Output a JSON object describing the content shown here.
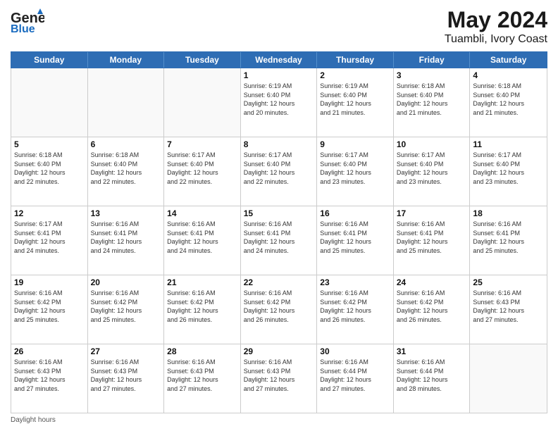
{
  "header": {
    "logo_line1": "General",
    "logo_line2": "Blue",
    "main_title": "May 2024",
    "subtitle": "Tuambli, Ivory Coast"
  },
  "calendar": {
    "weekdays": [
      "Sunday",
      "Monday",
      "Tuesday",
      "Wednesday",
      "Thursday",
      "Friday",
      "Saturday"
    ],
    "weeks": [
      [
        {
          "day": "",
          "info": ""
        },
        {
          "day": "",
          "info": ""
        },
        {
          "day": "",
          "info": ""
        },
        {
          "day": "1",
          "info": "Sunrise: 6:19 AM\nSunset: 6:40 PM\nDaylight: 12 hours\nand 20 minutes."
        },
        {
          "day": "2",
          "info": "Sunrise: 6:19 AM\nSunset: 6:40 PM\nDaylight: 12 hours\nand 21 minutes."
        },
        {
          "day": "3",
          "info": "Sunrise: 6:18 AM\nSunset: 6:40 PM\nDaylight: 12 hours\nand 21 minutes."
        },
        {
          "day": "4",
          "info": "Sunrise: 6:18 AM\nSunset: 6:40 PM\nDaylight: 12 hours\nand 21 minutes."
        }
      ],
      [
        {
          "day": "5",
          "info": "Sunrise: 6:18 AM\nSunset: 6:40 PM\nDaylight: 12 hours\nand 22 minutes."
        },
        {
          "day": "6",
          "info": "Sunrise: 6:18 AM\nSunset: 6:40 PM\nDaylight: 12 hours\nand 22 minutes."
        },
        {
          "day": "7",
          "info": "Sunrise: 6:17 AM\nSunset: 6:40 PM\nDaylight: 12 hours\nand 22 minutes."
        },
        {
          "day": "8",
          "info": "Sunrise: 6:17 AM\nSunset: 6:40 PM\nDaylight: 12 hours\nand 22 minutes."
        },
        {
          "day": "9",
          "info": "Sunrise: 6:17 AM\nSunset: 6:40 PM\nDaylight: 12 hours\nand 23 minutes."
        },
        {
          "day": "10",
          "info": "Sunrise: 6:17 AM\nSunset: 6:40 PM\nDaylight: 12 hours\nand 23 minutes."
        },
        {
          "day": "11",
          "info": "Sunrise: 6:17 AM\nSunset: 6:40 PM\nDaylight: 12 hours\nand 23 minutes."
        }
      ],
      [
        {
          "day": "12",
          "info": "Sunrise: 6:17 AM\nSunset: 6:41 PM\nDaylight: 12 hours\nand 24 minutes."
        },
        {
          "day": "13",
          "info": "Sunrise: 6:16 AM\nSunset: 6:41 PM\nDaylight: 12 hours\nand 24 minutes."
        },
        {
          "day": "14",
          "info": "Sunrise: 6:16 AM\nSunset: 6:41 PM\nDaylight: 12 hours\nand 24 minutes."
        },
        {
          "day": "15",
          "info": "Sunrise: 6:16 AM\nSunset: 6:41 PM\nDaylight: 12 hours\nand 24 minutes."
        },
        {
          "day": "16",
          "info": "Sunrise: 6:16 AM\nSunset: 6:41 PM\nDaylight: 12 hours\nand 25 minutes."
        },
        {
          "day": "17",
          "info": "Sunrise: 6:16 AM\nSunset: 6:41 PM\nDaylight: 12 hours\nand 25 minutes."
        },
        {
          "day": "18",
          "info": "Sunrise: 6:16 AM\nSunset: 6:41 PM\nDaylight: 12 hours\nand 25 minutes."
        }
      ],
      [
        {
          "day": "19",
          "info": "Sunrise: 6:16 AM\nSunset: 6:42 PM\nDaylight: 12 hours\nand 25 minutes."
        },
        {
          "day": "20",
          "info": "Sunrise: 6:16 AM\nSunset: 6:42 PM\nDaylight: 12 hours\nand 25 minutes."
        },
        {
          "day": "21",
          "info": "Sunrise: 6:16 AM\nSunset: 6:42 PM\nDaylight: 12 hours\nand 26 minutes."
        },
        {
          "day": "22",
          "info": "Sunrise: 6:16 AM\nSunset: 6:42 PM\nDaylight: 12 hours\nand 26 minutes."
        },
        {
          "day": "23",
          "info": "Sunrise: 6:16 AM\nSunset: 6:42 PM\nDaylight: 12 hours\nand 26 minutes."
        },
        {
          "day": "24",
          "info": "Sunrise: 6:16 AM\nSunset: 6:42 PM\nDaylight: 12 hours\nand 26 minutes."
        },
        {
          "day": "25",
          "info": "Sunrise: 6:16 AM\nSunset: 6:43 PM\nDaylight: 12 hours\nand 27 minutes."
        }
      ],
      [
        {
          "day": "26",
          "info": "Sunrise: 6:16 AM\nSunset: 6:43 PM\nDaylight: 12 hours\nand 27 minutes."
        },
        {
          "day": "27",
          "info": "Sunrise: 6:16 AM\nSunset: 6:43 PM\nDaylight: 12 hours\nand 27 minutes."
        },
        {
          "day": "28",
          "info": "Sunrise: 6:16 AM\nSunset: 6:43 PM\nDaylight: 12 hours\nand 27 minutes."
        },
        {
          "day": "29",
          "info": "Sunrise: 6:16 AM\nSunset: 6:43 PM\nDaylight: 12 hours\nand 27 minutes."
        },
        {
          "day": "30",
          "info": "Sunrise: 6:16 AM\nSunset: 6:44 PM\nDaylight: 12 hours\nand 27 minutes."
        },
        {
          "day": "31",
          "info": "Sunrise: 6:16 AM\nSunset: 6:44 PM\nDaylight: 12 hours\nand 28 minutes."
        },
        {
          "day": "",
          "info": ""
        }
      ]
    ]
  },
  "footer": {
    "note": "Daylight hours"
  }
}
